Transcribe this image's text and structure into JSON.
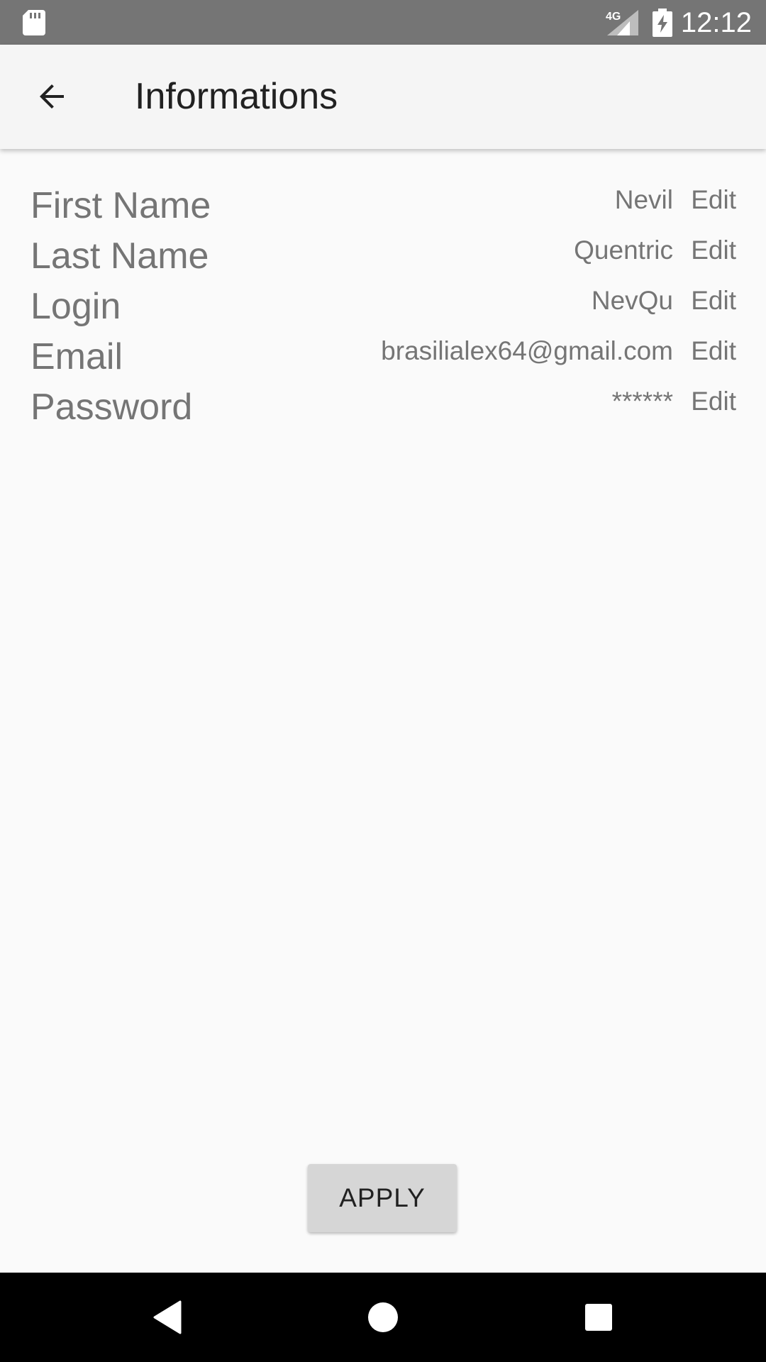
{
  "status_bar": {
    "network": "4G",
    "time": "12:12",
    "icons": [
      "sd-card-icon",
      "signal-icon",
      "battery-charging-icon"
    ]
  },
  "app_bar": {
    "back_icon": "arrow-back-icon",
    "title": "Informations"
  },
  "rows": [
    {
      "label": "First Name",
      "value": "Nevil",
      "action": "Edit"
    },
    {
      "label": "Last Name",
      "value": "Quentric",
      "action": "Edit"
    },
    {
      "label": "Login",
      "value": "NevQu",
      "action": "Edit"
    },
    {
      "label": "Email",
      "value": "brasilialex64@gmail.com",
      "action": "Edit"
    },
    {
      "label": "Password",
      "value": "******",
      "action": "Edit"
    }
  ],
  "apply_button": {
    "label": "APPLY"
  },
  "nav_bar": {
    "icons": [
      "back-triangle-icon",
      "home-circle-icon",
      "recents-square-icon"
    ]
  },
  "colors": {
    "status_bar": "#757575",
    "app_bar": "#f5f5f5",
    "background": "#fafafa",
    "text_secondary": "#757575",
    "text_primary": "#212121",
    "button": "#d6d6d6",
    "nav_bar": "#000000"
  }
}
